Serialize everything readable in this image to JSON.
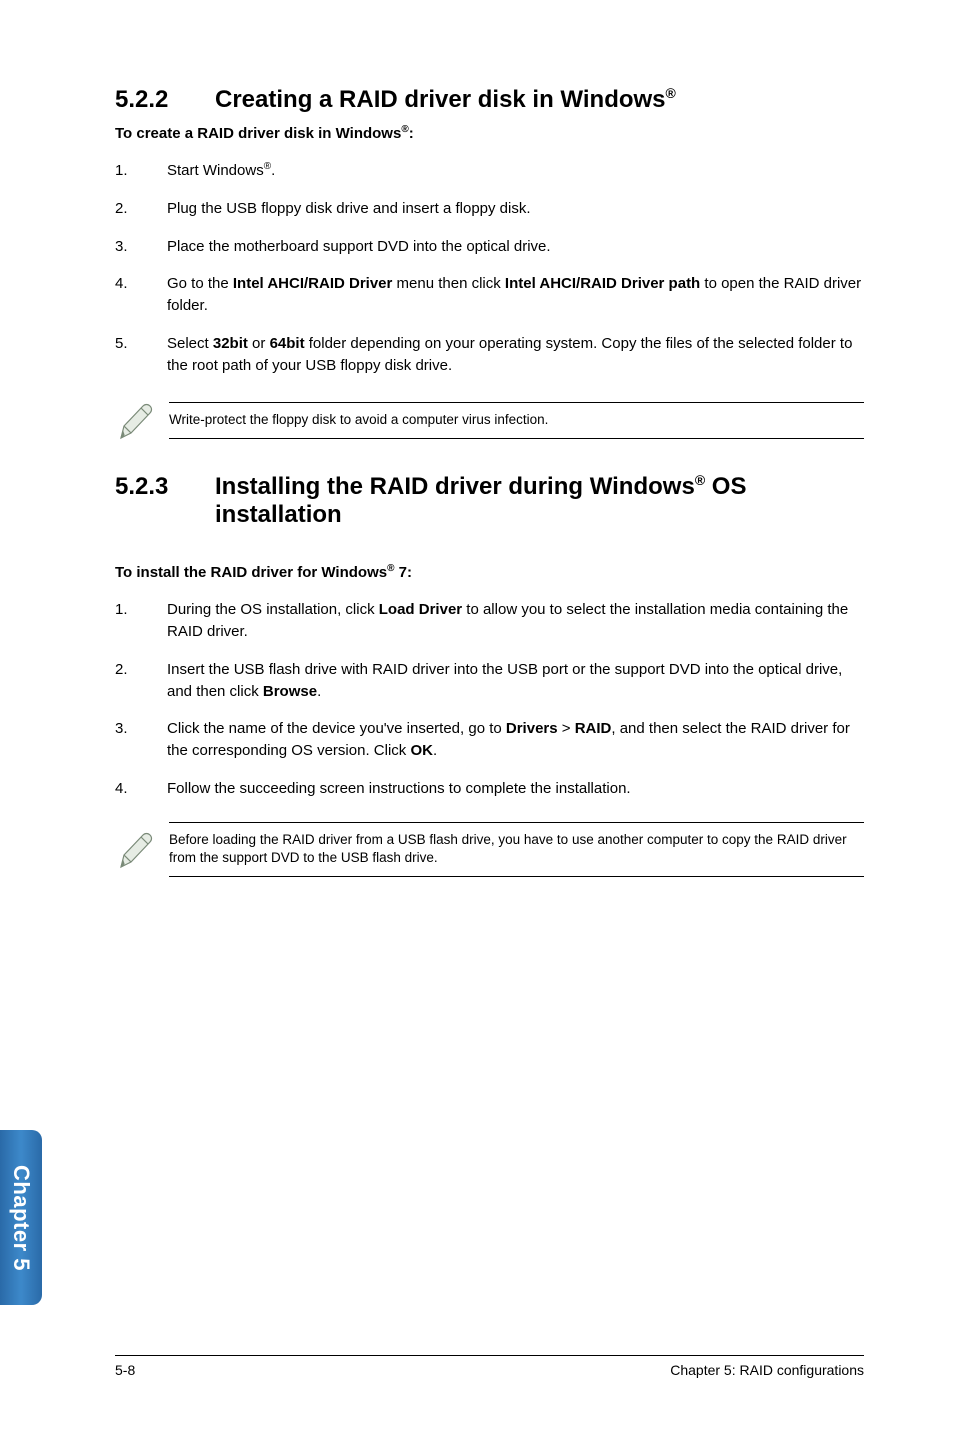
{
  "sec522": {
    "num": "5.2.2",
    "title_pre": "Creating a RAID driver disk in Windows",
    "title_sup": "®",
    "intro_pre": "To create a RAID driver disk in Windows",
    "intro_sup": "®",
    "intro_post": ":",
    "items": {
      "i1": {
        "n": "1.",
        "a": "Start Windows",
        "sup": "®",
        "b": "."
      },
      "i2": {
        "n": "2.",
        "t": "Plug the USB floppy disk drive and insert a floppy disk."
      },
      "i3": {
        "n": "3.",
        "t": "Place the motherboard support DVD into the optical drive."
      },
      "i4": {
        "n": "4.",
        "a": "Go to the ",
        "b1": "Intel AHCI/RAID Driver",
        "mid": " menu then click ",
        "b2": "Intel AHCI/RAID Driver path",
        "end": " to open the RAID driver folder."
      },
      "i5": {
        "n": "5.",
        "a": "Select ",
        "b1": "32bit",
        "mid": " or ",
        "b2": "64bit",
        "end": " folder depending on your operating system. Copy the files of the selected folder to the root path of your USB floppy disk drive."
      }
    },
    "note": "Write-protect the floppy disk to avoid a computer virus infection."
  },
  "sec523": {
    "num": "5.2.3",
    "title_a": "Installing the RAID driver during Windows",
    "title_sup": "®",
    "title_b": " OS installation",
    "intro_pre": "To install the RAID driver for Windows",
    "intro_sup": "®",
    "intro_post": " 7:",
    "items": {
      "i1": {
        "n": "1.",
        "a": "During the OS installation, click ",
        "b1": "Load Driver",
        "end": " to allow you to select the installation media containing the RAID driver."
      },
      "i2": {
        "n": "2.",
        "a": "Insert the USB flash drive with RAID driver into the USB port or the support DVD into the optical drive, and then click ",
        "b1": "Browse",
        "end": "."
      },
      "i3": {
        "n": "3.",
        "a": "Click the name of the device you've inserted, go to ",
        "b1": "Drivers",
        "mid": " > ",
        "b2": "RAID",
        "c": ", and then select the RAID driver for the corresponding OS version. Click ",
        "b3": "OK",
        "end": "."
      },
      "i4": {
        "n": "4.",
        "t": "Follow the succeeding screen instructions to complete the installation."
      }
    },
    "note": "Before loading the RAID driver from a USB flash drive, you have to use another computer to copy the RAID driver from the support DVD to the USB flash drive."
  },
  "sidebar": "Chapter 5",
  "footer": {
    "left": "5-8",
    "right": "Chapter 5: RAID configurations"
  }
}
